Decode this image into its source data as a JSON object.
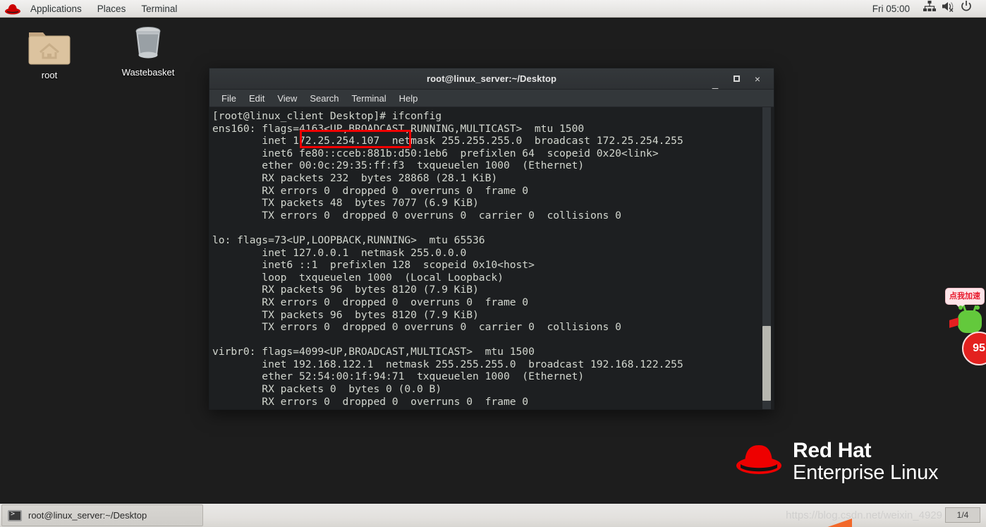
{
  "top_panel": {
    "logo_icon": "redhat-hat-icon",
    "menus": [
      "Applications",
      "Places",
      "Terminal"
    ],
    "clock": "Fri 05:00",
    "tray": [
      "network-icon",
      "volume-muted-icon",
      "power-icon"
    ]
  },
  "desktop": {
    "background_color": "#1d1d1d",
    "icons": [
      {
        "label": "root",
        "icon": "home-folder-icon"
      },
      {
        "label": "Wastebasket",
        "icon": "trash-bin-icon"
      }
    ],
    "branding": {
      "line1": "Red Hat",
      "line2": "Enterprise Linux",
      "logo_icon": "redhat-hat-icon"
    }
  },
  "terminal": {
    "title": "root@linux_server:~/Desktop",
    "window_controls": {
      "minimize": "_",
      "maximize": "□",
      "close": "×"
    },
    "menubar": [
      "File",
      "Edit",
      "View",
      "Search",
      "Terminal",
      "Help"
    ],
    "highlight_color": "#f00000",
    "highlighted_value": "172.25.254.107",
    "content": "[root@linux_client Desktop]# ifconfig\nens160: flags=4163<UP,BROADCAST,RUNNING,MULTICAST>  mtu 1500\n        inet 172.25.254.107  netmask 255.255.255.0  broadcast 172.25.254.255\n        inet6 fe80::cceb:881b:d50:1eb6  prefixlen 64  scopeid 0x20<link>\n        ether 00:0c:29:35:ff:f3  txqueuelen 1000  (Ethernet)\n        RX packets 232  bytes 28868 (28.1 KiB)\n        RX errors 0  dropped 0  overruns 0  frame 0\n        TX packets 48  bytes 7077 (6.9 KiB)\n        TX errors 0  dropped 0 overruns 0  carrier 0  collisions 0\n\nlo: flags=73<UP,LOOPBACK,RUNNING>  mtu 65536\n        inet 127.0.0.1  netmask 255.0.0.0\n        inet6 ::1  prefixlen 128  scopeid 0x10<host>\n        loop  txqueuelen 1000  (Local Loopback)\n        RX packets 96  bytes 8120 (7.9 KiB)\n        RX errors 0  dropped 0  overruns 0  frame 0\n        TX packets 96  bytes 8120 (7.9 KiB)\n        TX errors 0  dropped 0 overruns 0  carrier 0  collisions 0\n\nvirbr0: flags=4099<UP,BROADCAST,MULTICAST>  mtu 1500\n        inet 192.168.122.1  netmask 255.255.255.0  broadcast 192.168.122.255\n        ether 52:54:00:1f:94:71  txqueuelen 1000  (Ethernet)\n        RX packets 0  bytes 0 (0.0 B)\n        RX errors 0  dropped 0  overruns 0  frame 0"
  },
  "taskbar": {
    "window_button": {
      "label": "root@linux_server:~/Desktop",
      "icon": "terminal-icon"
    },
    "workspace_indicator": "1/4",
    "watermark": "https://blog.csdn.net/weixin_4929"
  },
  "ad_widget": {
    "bubble_text": "点我加速",
    "badge_text": "95",
    "character_icon": "green-mascot-icon"
  }
}
